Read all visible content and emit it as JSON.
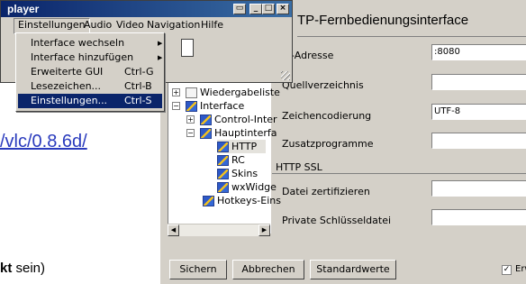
{
  "background_page": {
    "link_text": "/vlc/0.8.6d/",
    "bottom_text_bold": "kt",
    "bottom_text_rest": " sein)"
  },
  "player_window": {
    "title": "player",
    "menubar": [
      "Einstellungen",
      "Audio",
      "Video",
      "Navigation",
      "Hilfe"
    ],
    "window_buttons": {
      "minimize": "_",
      "maximize": "□",
      "close": "×"
    }
  },
  "dropdown": {
    "items": [
      {
        "label": "Interface wechseln",
        "shortcut": "",
        "submenu": true
      },
      {
        "label": "Interface hinzufügen",
        "shortcut": "",
        "submenu": true
      },
      {
        "label": "Erweiterte GUI",
        "shortcut": "Ctrl-G",
        "submenu": false
      },
      {
        "label": "Lesezeichen...",
        "shortcut": "Ctrl-B",
        "submenu": false
      },
      {
        "label": "Einstellungen...",
        "shortcut": "Ctrl-S",
        "submenu": false,
        "highlighted": true
      }
    ]
  },
  "prefs": {
    "title": "TP-Fernbedienungsinterface",
    "tree": [
      {
        "label": "Wiedergabeliste",
        "expander": "+",
        "icon": "page"
      },
      {
        "label": "Interface",
        "expander": "−",
        "icon": "folder"
      },
      {
        "label": "Control-Inter",
        "expander": "+",
        "icon": "folder"
      },
      {
        "label": "Hauptinterfa",
        "expander": "−",
        "icon": "folder"
      },
      {
        "label": "HTTP",
        "expander": "",
        "icon": "folder",
        "selected": true
      },
      {
        "label": "RC",
        "expander": "",
        "icon": "folder"
      },
      {
        "label": "Skins",
        "expander": "",
        "icon": "folder"
      },
      {
        "label": "wxWidge",
        "expander": "",
        "icon": "folder"
      },
      {
        "label": "Hotkeys-Eins",
        "expander": "",
        "icon": "folder"
      }
    ],
    "fields": [
      {
        "label": "st-Adresse",
        "value": ":8080"
      },
      {
        "label": "Quellverzeichnis",
        "value": ""
      },
      {
        "label": "Zeichencodierung",
        "value": "UTF-8"
      },
      {
        "label": "Zusatzprogramme",
        "value": ""
      },
      {
        "label": "Datei zertifizieren",
        "value": ""
      },
      {
        "label": "Private Schlüsseldatei",
        "value": ""
      }
    ],
    "section_ssl": "HTTP SSL",
    "buttons": {
      "save": "Sichern",
      "cancel": "Abbrechen",
      "defaults": "Standardwerte"
    },
    "checkbox": {
      "label": "Erw",
      "checked": true
    }
  }
}
